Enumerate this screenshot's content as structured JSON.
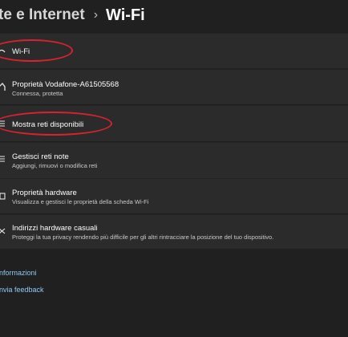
{
  "breadcrumb": {
    "parent": "te e Internet",
    "separator": "›",
    "current": "Wi-Fi"
  },
  "cards": [
    {
      "title": "Wi-Fi",
      "icon": "wifi-icon"
    },
    {
      "title": "Proprietà Vodafone-A61505568",
      "subtitle": "Connessa, protetta",
      "icon": "house-icon"
    },
    {
      "title": "Mostra reti disponibili",
      "icon": "list-icon"
    },
    {
      "title": "Gestisci reti note",
      "subtitle": "Aggiungi, rimuovi o modifica reti",
      "icon": "list-icon"
    },
    {
      "title": "Proprietà hardware",
      "subtitle": "Visualizza e gestisci le proprietà della scheda Wi-Fi",
      "icon": "chip-icon"
    },
    {
      "title": "Indirizzi hardware casuali",
      "subtitle": "Proteggi la tua privacy rendendo più difficile per gli altri rintracciare la posizione del tuo dispositivo.",
      "icon": "shuffle-icon"
    }
  ],
  "links": {
    "info": "nformazioni",
    "feedback": "nvia feedback"
  },
  "colors": {
    "background": "#202020",
    "card": "#2b2b2b",
    "link": "#8fc9f2",
    "annotation": "#d9222f"
  }
}
